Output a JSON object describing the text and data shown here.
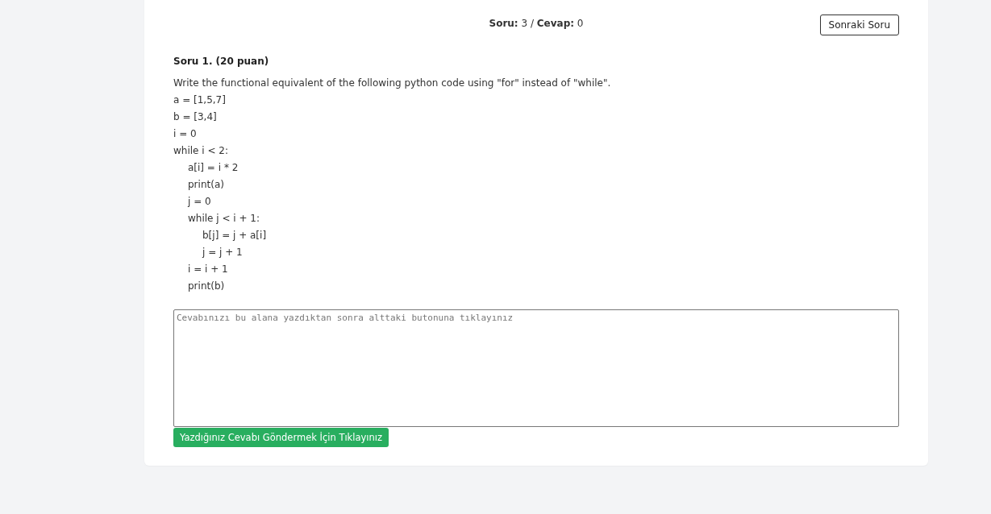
{
  "status": "**Soru:** 3 / **Cevap:** 0",
  "next_button": "Sonraki Soru",
  "question": {
    "title": "Soru 1. (20 puan)",
    "prompt": "Write the functional equivalent of the following python code using \"for\" instead of \"while\".",
    "code_lines": [
      {
        "text": "a = [1,5,7]"
      },
      {
        "text": "b = [3,4]"
      },
      {
        "text": "i = 0"
      },
      {
        "text": "while i < 2:",
        "children": [
          {
            "text": "a[i] = i * 2"
          },
          {
            "text": "print(a)"
          },
          {
            "text": "j = 0"
          },
          {
            "text": "while j < i + 1:",
            "children": [
              {
                "text": "b[j] = j + a[i]"
              },
              {
                "text": "j = j + 1"
              }
            ]
          },
          {
            "text": "i = i + 1"
          },
          {
            "text": "print(b)"
          }
        ]
      }
    ]
  },
  "answer": {
    "placeholder": "Cevabınızı bu alana yazdıktan sonra alttaki butonuna tıklayınız"
  },
  "submit_button": "Yazdığınız Cevabı Göndermek İçin Tıklayınız"
}
